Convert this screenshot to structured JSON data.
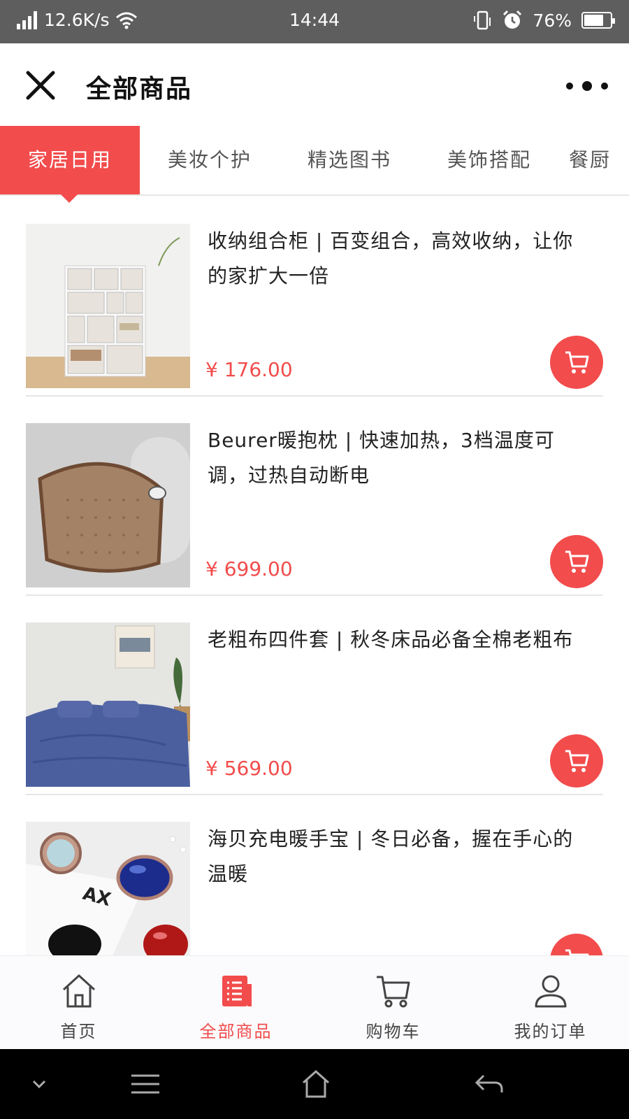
{
  "status_bar": {
    "speed": "12.6K/s",
    "time": "14:44",
    "battery_percent": "76%",
    "battery_level": 0.76,
    "icons": [
      "signal-icon",
      "wifi-icon",
      "vibrate-icon",
      "alarm-icon",
      "battery-icon"
    ]
  },
  "header": {
    "title": "全部商品",
    "close_icon": "close-icon",
    "more_icon": "more-icon"
  },
  "tabs": [
    {
      "label": "家居日用",
      "active": true
    },
    {
      "label": "美妆个护",
      "active": false
    },
    {
      "label": "精选图书",
      "active": false
    },
    {
      "label": "美饰搭配",
      "active": false
    },
    {
      "label": "餐厨",
      "active": false
    }
  ],
  "products": [
    {
      "name": "收纳组合柜 | 百变组合，高效收纳，让你的家扩大一倍",
      "price": "¥ 176.00"
    },
    {
      "name": "Beurer暖抱枕 | 快速加热，3档温度可调，过热自动断电",
      "price": "¥ 699.00"
    },
    {
      "name": "老粗布四件套 | 秋冬床品必备全棉老粗布",
      "price": "¥ 569.00"
    },
    {
      "name": "海贝充电暖手宝 | 冬日必备，握在手心的温暖",
      "price": ""
    }
  ],
  "bottom_nav": [
    {
      "label": "首页",
      "icon": "home-icon",
      "active": false
    },
    {
      "label": "全部商品",
      "icon": "list-icon",
      "active": true
    },
    {
      "label": "购物车",
      "icon": "cart-icon",
      "active": false
    },
    {
      "label": "我的订单",
      "icon": "user-icon",
      "active": false
    }
  ],
  "colors": {
    "accent": "#f24c4c",
    "status_bar": "#5e5e5e",
    "divider": "#e6e6e6",
    "text": "#222222"
  }
}
